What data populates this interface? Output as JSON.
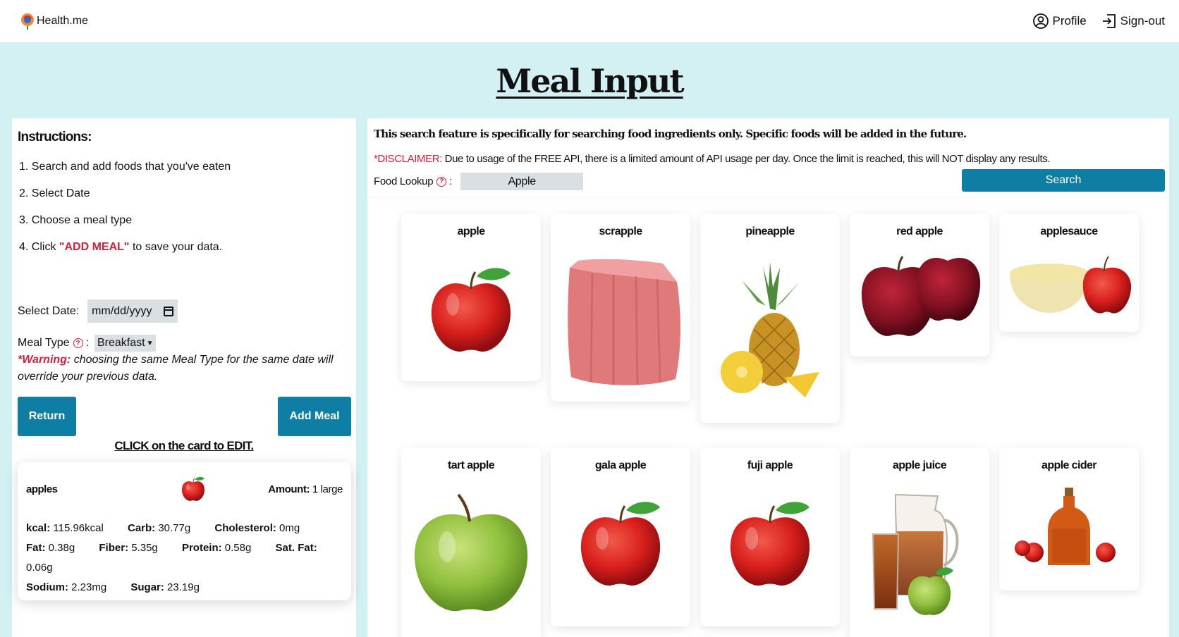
{
  "nav": {
    "brand": "Health.me",
    "profile": "Profile",
    "signout": "Sign-out"
  },
  "page": {
    "title": "Meal Input"
  },
  "instructions": {
    "title": "Instructions:",
    "step1": "1. Search and add foods that you've eaten",
    "step2": "2. Select Date",
    "step3": "3. Choose a meal type",
    "step4_pre": "4. Click ",
    "step4_strong": "\"ADD MEAL\"",
    "step4_post": " to save your data."
  },
  "form": {
    "date_label": "Select Date:",
    "date_placeholder": "mm/dd/yyyy",
    "meal_label": "Meal Type",
    "meal_colon": ":",
    "meal_value": "Breakfast",
    "warning_label": "*Warning:",
    "warning_text": " choosing the same Meal Type for the same date will override your previous data.",
    "return_label": "Return",
    "add_label": "Add Meal",
    "edit_hint": "CLICK on the card to EDIT."
  },
  "meal_card": {
    "name": "apples",
    "amount_label": "Amount:",
    "amount_value": " 1 large",
    "kcal_label": "kcal:",
    "kcal_value": " 115.96kcal",
    "carb_label": "Carb:",
    "carb_value": " 30.77g",
    "chol_label": "Cholesterol:",
    "chol_value": " 0mg",
    "fat_label": "Fat:",
    "fat_value": " 0.38g",
    "fiber_label": "Fiber:",
    "fiber_value": " 5.35g",
    "protein_label": "Protein:",
    "protein_value": " 0.58g",
    "satfat_label": "Sat. Fat:",
    "satfat_value": " 0.06g",
    "sodium_label": "Sodium:",
    "sodium_value": " 2.23mg",
    "sugar_label": "Sugar:",
    "sugar_value": " 23.19g"
  },
  "search": {
    "note": "This search feature is specifically for searching food ingredients only. Specific foods will be added in the future.",
    "disclaimer_label": "*DISCLAIMER:",
    "disclaimer_text": " Due to usage of the FREE API, there is a limited amount of API usage per day. Once the limit is reached, this will NOT display any results.",
    "lookup_label": "Food Lookup",
    "lookup_colon": ":",
    "lookup_value": "Apple",
    "button": "Search"
  },
  "results": [
    {
      "title": "apple",
      "icon": "red-apple"
    },
    {
      "title": "scrapple",
      "icon": "scrapple-loaf"
    },
    {
      "title": "pineapple",
      "icon": "pineapple"
    },
    {
      "title": "red apple",
      "icon": "two-red-apples"
    },
    {
      "title": "applesauce",
      "icon": "applesauce-bowl"
    },
    {
      "title": "tart apple",
      "icon": "green-apple"
    },
    {
      "title": "gala apple",
      "icon": "red-apple"
    },
    {
      "title": "fuji apple",
      "icon": "red-apple"
    },
    {
      "title": "apple juice",
      "icon": "juice-pitcher"
    },
    {
      "title": "apple cider",
      "icon": "cider-bottle"
    }
  ],
  "colors": {
    "accent": "#0f7ea5",
    "warning": "#d61f3a",
    "background": "#d3f0f2"
  }
}
